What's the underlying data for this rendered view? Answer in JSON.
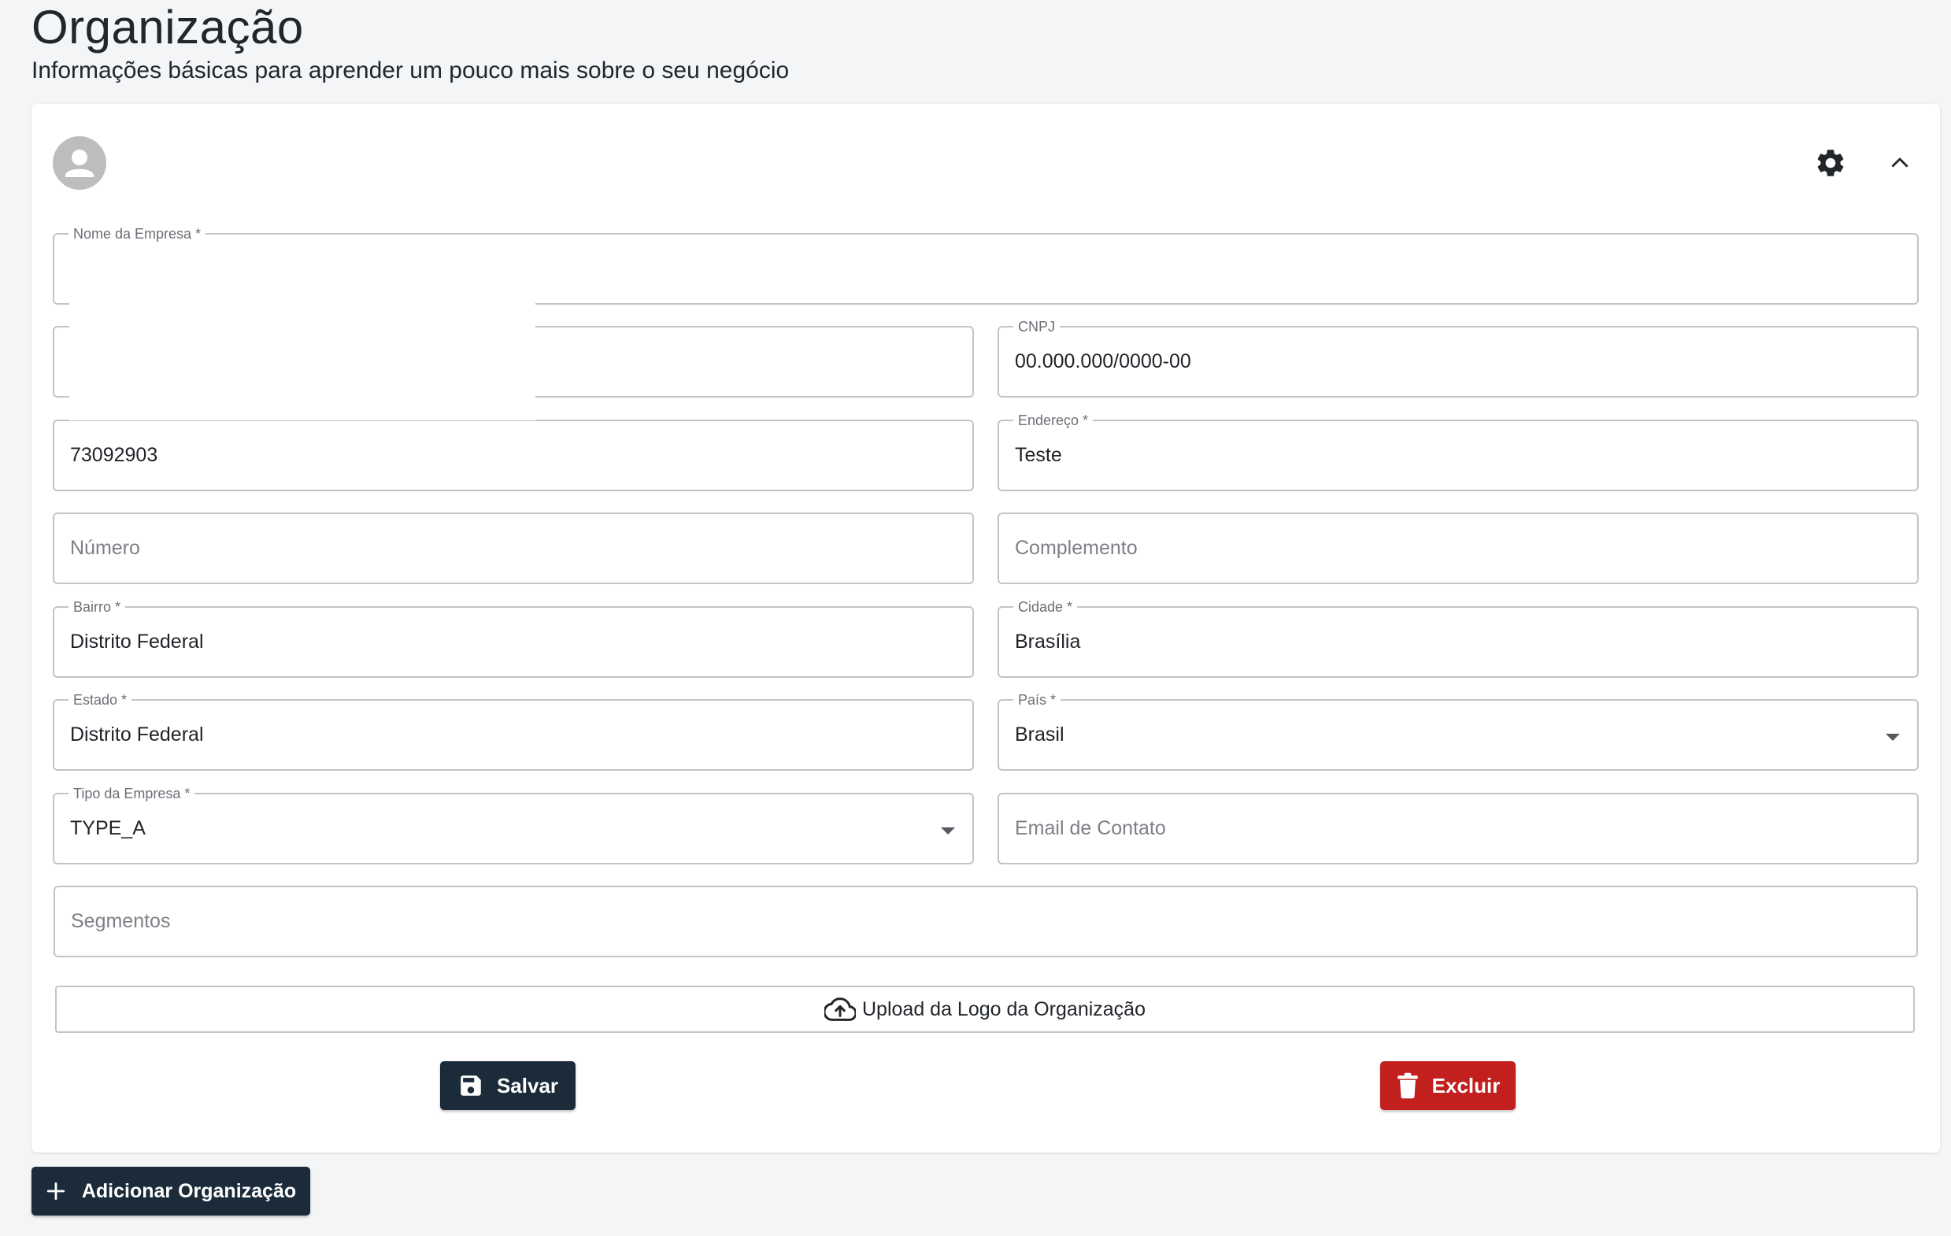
{
  "page": {
    "title": "Organização",
    "subtitle": "Informações básicas para aprender um pouco mais sobre o seu negócio"
  },
  "form": {
    "company_name": {
      "label": "Nome da Empresa *",
      "value": ""
    },
    "field_row2_left": {
      "label": "",
      "value": ""
    },
    "cnpj": {
      "label": "CNPJ",
      "value": "00.000.000/0000-00"
    },
    "field_row3_left": {
      "label": "",
      "value": "73092903"
    },
    "address": {
      "label": "Endereço *",
      "value": "Teste"
    },
    "number": {
      "placeholder": "Número"
    },
    "complement": {
      "placeholder": "Complemento"
    },
    "neighborhood": {
      "label": "Bairro *",
      "value": "Distrito Federal"
    },
    "city": {
      "label": "Cidade *",
      "value": "Brasília"
    },
    "state": {
      "label": "Estado *",
      "value": "Distrito Federal"
    },
    "country": {
      "label": "País *",
      "value": "Brasil"
    },
    "company_type": {
      "label": "Tipo da Empresa *",
      "value": "TYPE_A"
    },
    "contact_email": {
      "placeholder": "Email de Contato"
    },
    "segments": {
      "placeholder": "Segmentos"
    }
  },
  "actions": {
    "upload_label": "Upload da Logo da Organização",
    "save_label": "Salvar",
    "delete_label": "Excluir",
    "add_org_label": "Adicionar Organização"
  },
  "icons": {
    "avatar": "person-avatar-icon",
    "settings": "gear-icon",
    "collapse": "chevron-up-icon",
    "upload": "cloud-upload-icon",
    "save": "floppy-disk-icon",
    "delete": "trash-icon",
    "add": "plus-icon"
  },
  "colors": {
    "primary": "#1c2b3a",
    "danger": "#c21f1f",
    "background": "#f4f5f7",
    "border": "#c4c4c4"
  }
}
